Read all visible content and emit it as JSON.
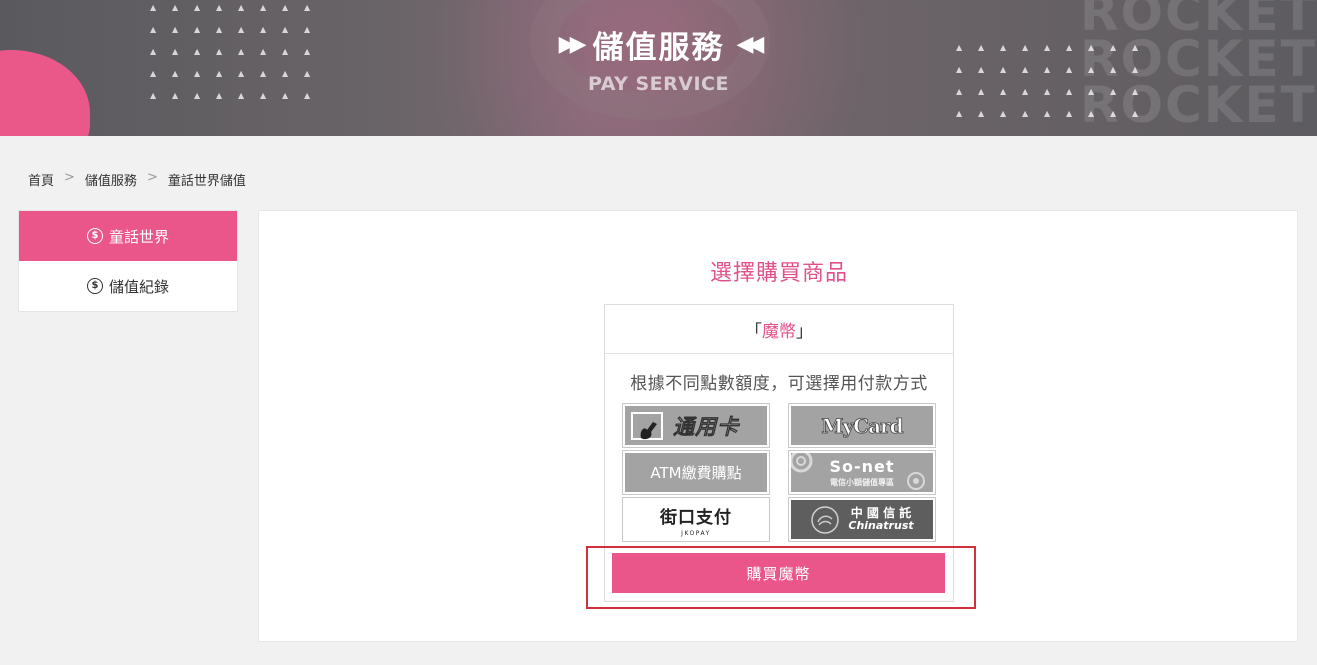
{
  "banner": {
    "title": "儲值服務",
    "subtitle": "PAY SERVICE",
    "arrow_left": "▶▶",
    "arrow_right": "◀◀",
    "watermark": "ROCKET G\nROCKET G\nROCKET G"
  },
  "breadcrumb": {
    "items": [
      "首頁",
      "儲值服務",
      "童話世界儲值"
    ],
    "separator": ">"
  },
  "sidebar": {
    "items": [
      {
        "label": "童話世界",
        "icon": "dollar-coin-icon",
        "active": true
      },
      {
        "label": "儲值紀錄",
        "icon": "dollar-coin-icon",
        "active": false
      }
    ]
  },
  "main": {
    "title": "選擇購買商品",
    "product": {
      "bracket_open": "「",
      "name": "魔幣",
      "bracket_close": "」"
    },
    "description": "根據不同點數額度，可選擇用付款方式",
    "payment_methods": [
      {
        "label": "通用卡",
        "icon": "gash-card-logo"
      },
      {
        "label": "MyCard",
        "icon": "mycard-logo"
      },
      {
        "label": "ATM繳費購點",
        "icon": "atm-logo"
      },
      {
        "label": "So-net",
        "sublabel": "電信小額儲值專區",
        "icon": "sonet-logo"
      },
      {
        "label": "街口支付",
        "sublabel": "JKOPAY",
        "icon": "jkopay-logo"
      },
      {
        "label": "中 國 信 託",
        "sublabel": "Chinatrust",
        "icon": "chinatrust-logo"
      }
    ],
    "buy_button": "購買魔幣"
  },
  "colors": {
    "accent": "#eb568a",
    "highlight_border": "#d32f3a"
  }
}
